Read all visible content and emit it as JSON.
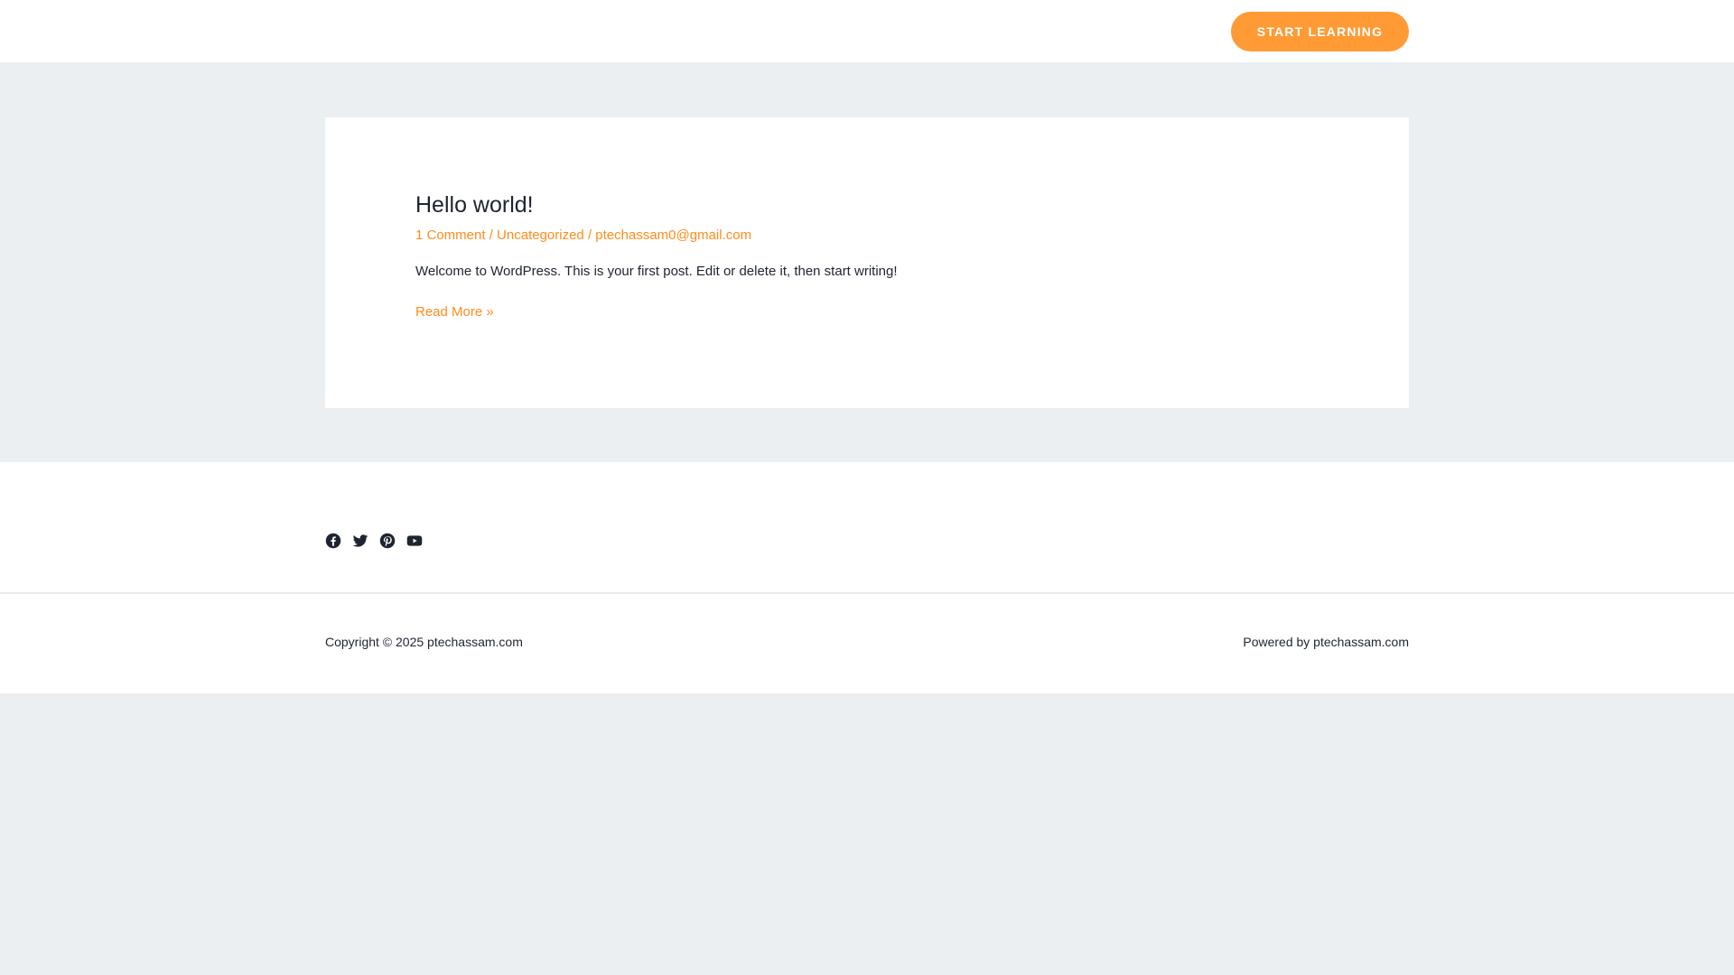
{
  "header": {
    "cta_label": "START LEARNING"
  },
  "post": {
    "title": "Hello world!",
    "meta": {
      "comments": "1 Comment",
      "separator": " / ",
      "category": "Uncategorized",
      "author": "ptechassam0@gmail.com"
    },
    "excerpt": "Welcome to WordPress. This is your first post. Edit or delete it, then start writing!",
    "read_more": "Read More »"
  },
  "footer": {
    "social_icons": [
      "facebook-icon",
      "twitter-icon",
      "pinterest-icon",
      "youtube-icon"
    ],
    "copyright": "Copyright © 2025 ptechassam.com",
    "powered_by": "Powered by ptechassam.com"
  },
  "colors": {
    "accent": "#ff9a35",
    "link": "#ff8c1a",
    "page_background": "#ebeff2",
    "text": "#1e2430"
  }
}
